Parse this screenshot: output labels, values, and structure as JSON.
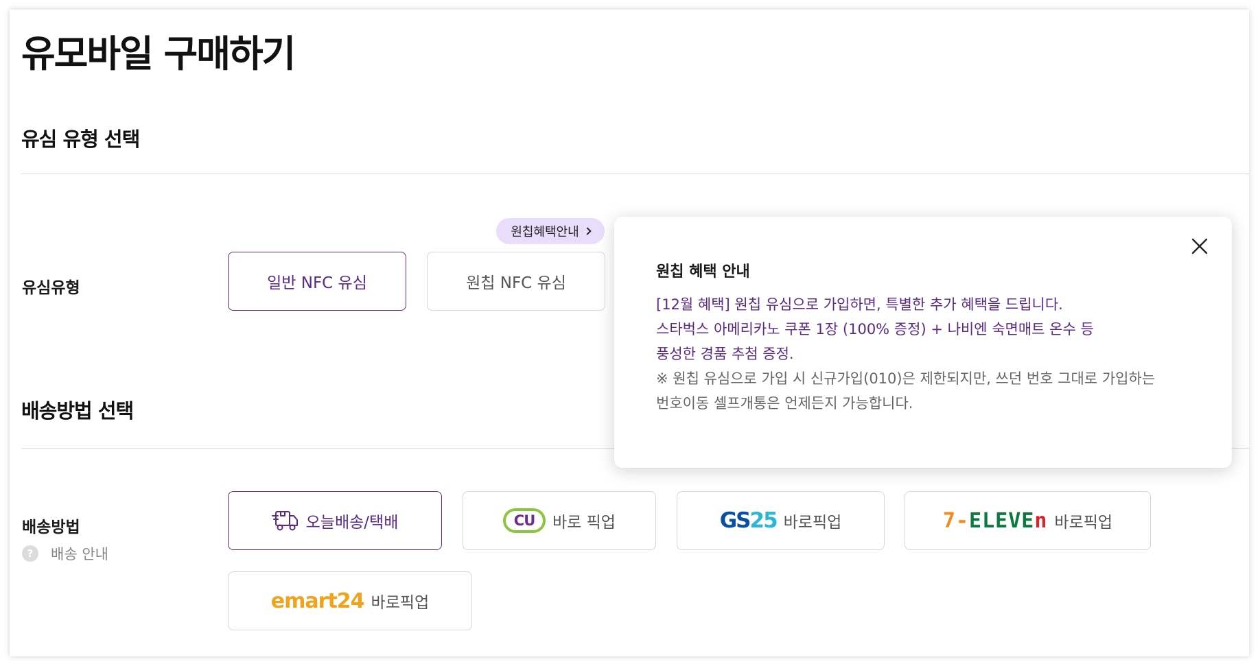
{
  "page": {
    "title": "유모바일 구매하기"
  },
  "sim_section": {
    "title": "유심 유형 선택",
    "row_label": "유심유형",
    "benefit_pill": "원칩혜택안내",
    "options": [
      {
        "label": "일반 NFC 유심",
        "selected": true
      },
      {
        "label": "원칩 NFC 유심",
        "selected": false
      }
    ]
  },
  "delivery_section": {
    "title": "배송방법 선택",
    "row_label": "배송방법",
    "help_label": "배송 안내",
    "help_icon": "?",
    "options": [
      {
        "label": "오늘배송/택배",
        "icon": "delivery-truck-icon",
        "selected": true
      },
      {
        "brand": "CU",
        "label": "바로 픽업",
        "selected": false
      },
      {
        "brand_a": "GS",
        "brand_b": "25",
        "label": "바로픽업",
        "selected": false
      },
      {
        "brand_a": "7-",
        "brand_b": "ELEVE",
        "brand_c": "n",
        "label": "바로픽업",
        "selected": false
      },
      {
        "brand_a": "emart",
        "brand_b": "24",
        "label": "바로픽업",
        "selected": false
      }
    ]
  },
  "popover": {
    "title": "원칩 혜택 안내",
    "lines": [
      "[12월 혜택] 원칩 유심으로 가입하면, 특별한 추가 혜택을 드립니다.",
      "스타벅스 아메리카노 쿠폰 1장 (100% 증정) + 나비엔 숙면매트 온수 등",
      "풍성한 경품 추첨 증정.",
      "※ 원칩 유심으로 가입 시 신규가입(010)은 제한되지만, 쓰던 번호 그대로 가입하는",
      "번호이동 셀프개통은 언제든지 가능합니다."
    ]
  },
  "colors": {
    "accent_purple": "#5b2a86",
    "pill_bg": "#eadcfb",
    "border": "#d6d6d6"
  }
}
